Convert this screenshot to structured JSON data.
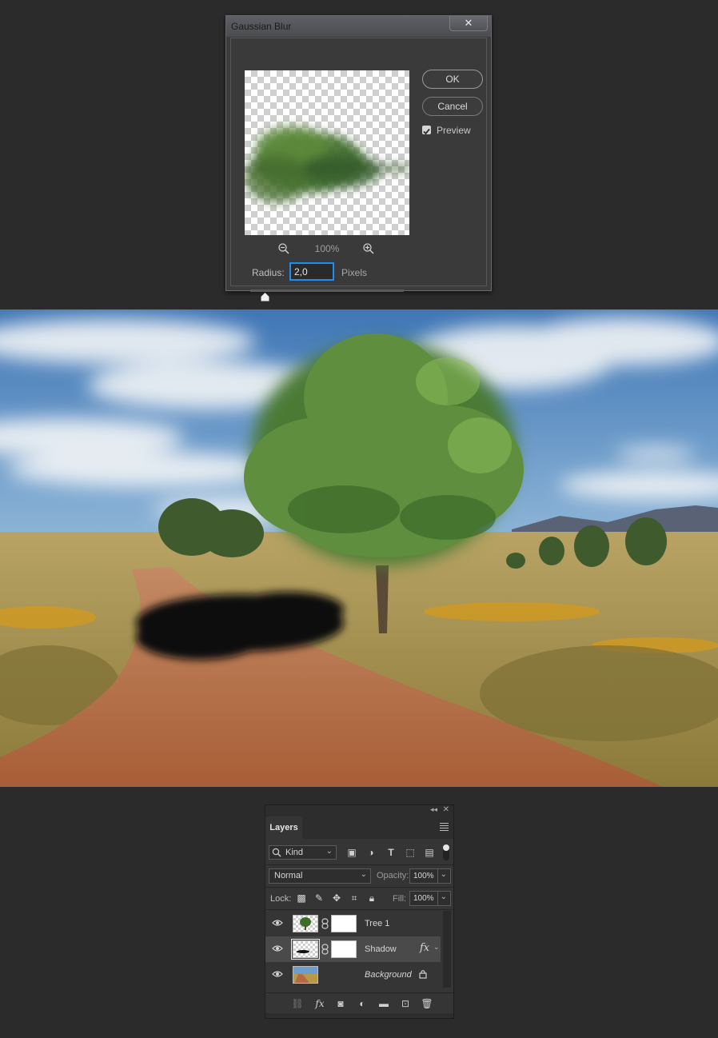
{
  "dialog": {
    "title": "Gaussian Blur",
    "close_symbol": "✕",
    "ok_label": "OK",
    "cancel_label": "Cancel",
    "preview_label": "Preview",
    "preview_checked": true,
    "zoom_level": "100%",
    "radius_label": "Radius:",
    "radius_value": "2,0",
    "radius_units": "Pixels",
    "accent_color": "#1d8ff0"
  },
  "scene": {
    "description_icon": "tree-photo",
    "sky_color": "#4f86c2",
    "field_color": "#b69a4a",
    "road_color": "#b46a42"
  },
  "layers_panel": {
    "tab_label": "Layers",
    "filter": {
      "kind_label": "Kind"
    },
    "blend_mode": "Normal",
    "opacity_label": "Opacity:",
    "opacity_value": "100%",
    "lock_label": "Lock:",
    "fill_label": "Fill:",
    "fill_value": "100%",
    "layers": [
      {
        "name": "Tree 1",
        "visible": true,
        "has_mask": true,
        "selected": false
      },
      {
        "name": "Shadow",
        "visible": true,
        "has_mask": true,
        "selected": true,
        "fx": "fx"
      },
      {
        "name": "Background",
        "visible": true,
        "locked": true,
        "selected": false
      }
    ]
  }
}
